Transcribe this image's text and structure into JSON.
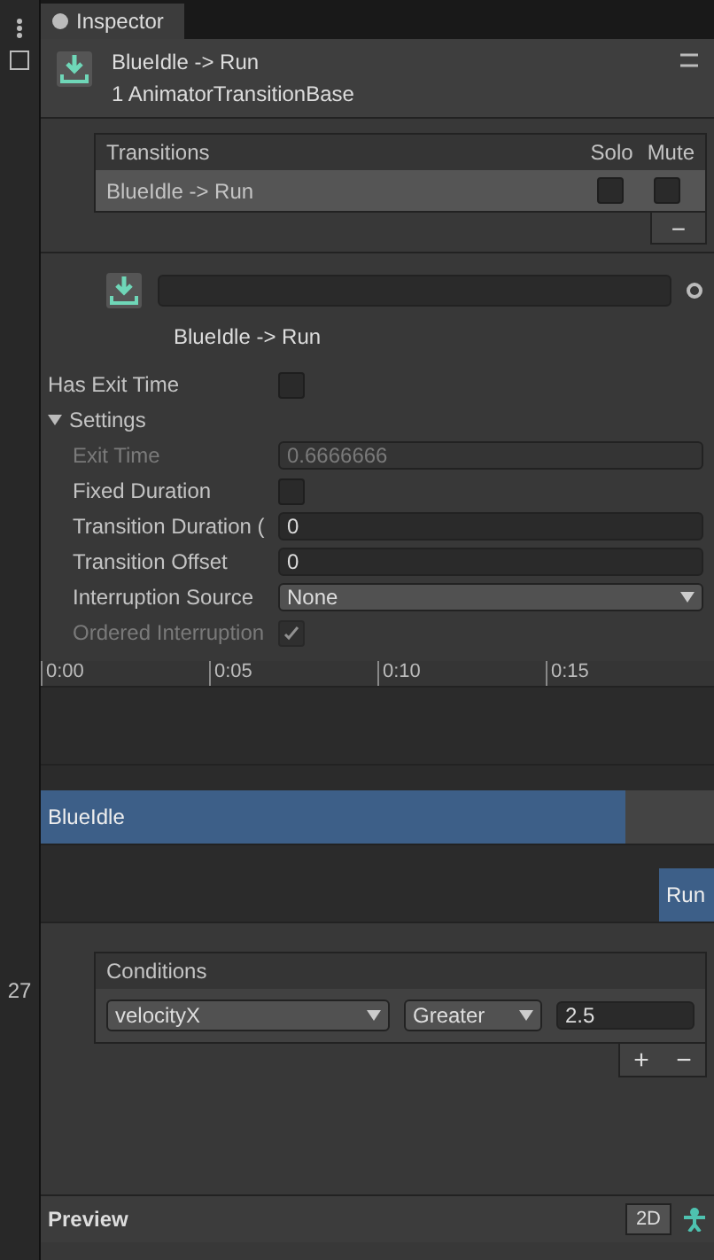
{
  "inspector": {
    "tab": "Inspector",
    "title": "BlueIdle -> Run",
    "subtitle": "1 AnimatorTransitionBase"
  },
  "transitions": {
    "header": "Transitions",
    "solo_label": "Solo",
    "mute_label": "Mute",
    "rows": [
      {
        "name": "BlueIdle -> Run",
        "solo": false,
        "mute": false,
        "selected": true
      }
    ],
    "remove": "−"
  },
  "transition": {
    "caption": "BlueIdle -> Run"
  },
  "settings": [
    {
      "kind": "check",
      "label": "Has Exit Time",
      "checked": false,
      "disabled": false
    },
    {
      "kind": "foldout",
      "label": "Settings",
      "expanded": true
    },
    {
      "kind": "field",
      "label": "Exit Time",
      "value": "0.6666666",
      "disabled": true
    },
    {
      "kind": "check",
      "label": "Fixed Duration",
      "checked": false,
      "disabled": false
    },
    {
      "kind": "field",
      "label": "Transition Duration (",
      "value": "0",
      "disabled": false
    },
    {
      "kind": "field",
      "label": "Transition Offset",
      "value": "0",
      "disabled": false
    },
    {
      "kind": "dropdown",
      "label": "Interruption Source",
      "value": "None",
      "disabled": false
    },
    {
      "kind": "check",
      "label": "Ordered Interruption",
      "checked": true,
      "disabled": true
    }
  ],
  "timeline": {
    "ticks": [
      "0:00",
      "0:05",
      "0:10",
      "0:15"
    ],
    "source_clip": "BlueIdle",
    "dest_clip": "Run"
  },
  "conditions": {
    "header": "Conditions",
    "rows": [
      {
        "parameter": "velocityX",
        "mode": "Greater",
        "value": "2.5"
      }
    ],
    "add": "+",
    "remove": "−"
  },
  "preview": {
    "label": "Preview",
    "mode": "2D"
  },
  "left_strip": {
    "number": "27"
  }
}
